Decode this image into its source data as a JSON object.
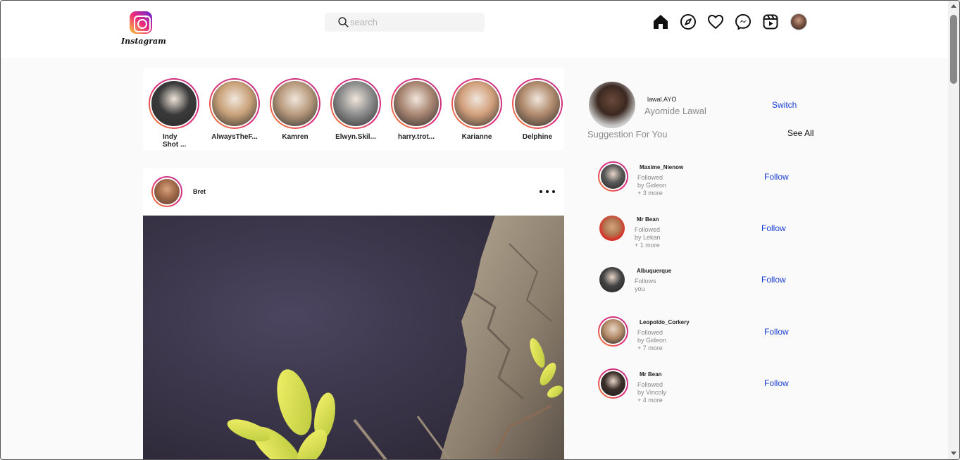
{
  "app": {
    "logo_text": "Instagram"
  },
  "search": {
    "placeholder": "search"
  },
  "nav": {
    "icons": [
      "home-icon",
      "explore-icon",
      "heart-icon",
      "messenger-icon",
      "reels-icon",
      "profile-avatar"
    ]
  },
  "stories": [
    {
      "name": "Indy Shot ...",
      "tone": "#3a3a3a"
    },
    {
      "name": "AlwaysTheF...",
      "tone": "#c9a27a"
    },
    {
      "name": "Kamren",
      "tone": "#b89a7d"
    },
    {
      "name": "Elwyn.Skil...",
      "tone": "#8d8d8d"
    },
    {
      "name": "harry.trot...",
      "tone": "#a98672"
    },
    {
      "name": "Karianne",
      "tone": "#d2a07c"
    },
    {
      "name": "Delphine",
      "tone": "#b08a6d"
    }
  ],
  "post": {
    "username": "Bret",
    "more_icon": "more-horizontal-icon"
  },
  "me": {
    "username": "lawal.AYO",
    "full_name": "Ayomide Lawal",
    "switch_label": "Switch"
  },
  "suggestions": {
    "title": "Suggestion For You",
    "see_all": "See All",
    "follow_label": "Follow",
    "items": [
      {
        "username": "Maxime_Nienow",
        "note": "Followed by Gideon + 3 more",
        "tone": "#5a5a5a",
        "ring": true
      },
      {
        "username": "Mr Bean",
        "note": "Followed by Lekan + 1 more",
        "tone": "#b07a55",
        "ring": false
      },
      {
        "username": "Albuquerque",
        "note": "Follows you",
        "tone": "#444444",
        "ring": false
      },
      {
        "username": "Leopoldo_Corkery",
        "note": "Followed by Gideon + 7 more",
        "tone": "#b58d6b",
        "ring": true
      },
      {
        "username": "Mr Bean",
        "note": "Followed by Vincoly + 4 more",
        "tone": "#3b2f2a",
        "ring": true
      }
    ]
  },
  "colors": {
    "accent": "#1b3fd1",
    "ring_start": "#f58529",
    "ring_end": "#c13584"
  }
}
